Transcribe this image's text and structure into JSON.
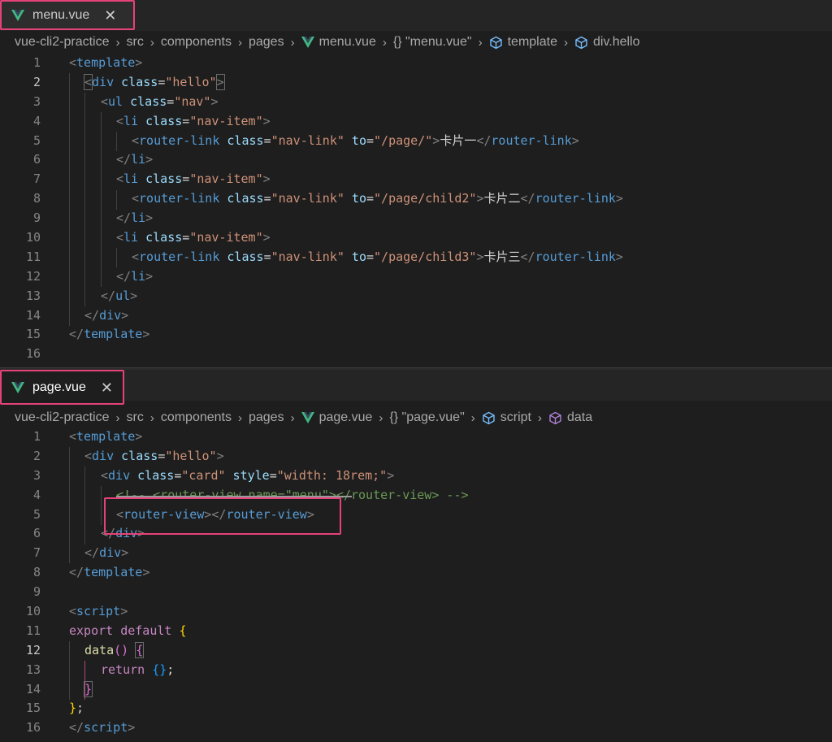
{
  "editor1": {
    "tab": {
      "title": "menu.vue",
      "close": "✕"
    },
    "breadcrumb": [
      "vue-cli2-practice",
      "src",
      "components",
      "pages",
      "menu.vue",
      "{} \"menu.vue\"",
      "template",
      "div.hello"
    ],
    "line_numbers": [
      "1",
      "2",
      "3",
      "4",
      "5",
      "6",
      "7",
      "8",
      "9",
      "10",
      "11",
      "12",
      "13",
      "14",
      "15",
      "16"
    ],
    "lines": [
      [
        "<",
        "template",
        ">"
      ],
      [
        "<",
        "div",
        " class",
        "=",
        "\"hello\"",
        ">"
      ],
      [
        "<",
        "ul",
        " class",
        "=",
        "\"nav\"",
        ">"
      ],
      [
        "<",
        "li",
        " class",
        "=",
        "\"nav-item\"",
        ">"
      ],
      [
        "<",
        "router-link",
        " class",
        "=",
        "\"nav-link\"",
        " to",
        "=",
        "\"/page/\"",
        ">",
        "卡片一",
        "</",
        "router-link",
        ">"
      ],
      [
        "</",
        "li",
        ">"
      ],
      [
        "<",
        "li",
        " class",
        "=",
        "\"nav-item\"",
        ">"
      ],
      [
        "<",
        "router-link",
        " class",
        "=",
        "\"nav-link\"",
        " to",
        "=",
        "\"/page/child2\"",
        ">",
        "卡片二",
        "</",
        "router-link",
        ">"
      ],
      [
        "</",
        "li",
        ">"
      ],
      [
        "<",
        "li",
        " class",
        "=",
        "\"nav-item\"",
        ">"
      ],
      [
        "<",
        "router-link",
        " class",
        "=",
        "\"nav-link\"",
        " to",
        "=",
        "\"/page/child3\"",
        ">",
        "卡片三",
        "</",
        "router-link",
        ">"
      ],
      [
        "</",
        "li",
        ">"
      ],
      [
        "</",
        "ul",
        ">"
      ],
      [
        "</",
        "div",
        ">"
      ],
      [
        "</",
        "template",
        ">"
      ],
      []
    ]
  },
  "editor2": {
    "tab": {
      "title": "page.vue",
      "close": "✕"
    },
    "breadcrumb": [
      "vue-cli2-practice",
      "src",
      "components",
      "pages",
      "page.vue",
      "{} \"page.vue\"",
      "script",
      "data"
    ],
    "line_numbers": [
      "1",
      "2",
      "3",
      "4",
      "5",
      "6",
      "7",
      "8",
      "9",
      "10",
      "11",
      "12",
      "13",
      "14",
      "15",
      "16"
    ],
    "lines": [
      [
        "<",
        "template",
        ">"
      ],
      [
        "<",
        "div",
        " class",
        "=",
        "\"hello\"",
        ">"
      ],
      [
        "<",
        "div",
        " class",
        "=",
        "\"card\"",
        " style",
        "=",
        "\"width: 18rem;\"",
        ">"
      ],
      [
        "<!-- <router-view name=\"menu\"></router-view> -->"
      ],
      [
        "<",
        "router-view",
        "></",
        "router-view",
        ">"
      ],
      [
        "</",
        "div",
        ">"
      ],
      [
        "</",
        "div",
        ">"
      ],
      [
        "</",
        "template",
        ">"
      ],
      [],
      [
        "<",
        "script",
        ">"
      ],
      [
        "export default",
        " ",
        "{"
      ],
      [
        "data",
        "()",
        " ",
        "{"
      ],
      [
        "return",
        " ",
        "{}",
        ";"
      ],
      [
        "}"
      ],
      [
        "}",
        ";"
      ],
      [
        "</",
        "script",
        ">"
      ]
    ]
  },
  "colors": {
    "accent_outline": "#e5427a",
    "vue_green": "#41b883"
  }
}
